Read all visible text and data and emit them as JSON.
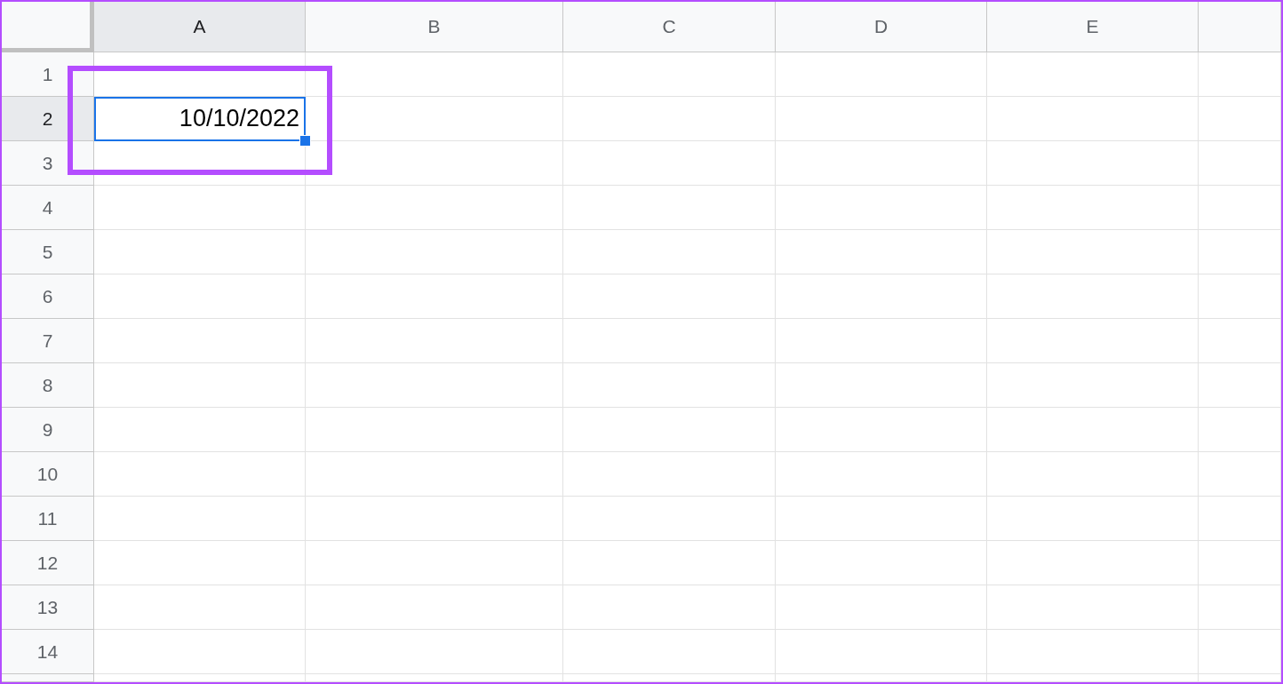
{
  "columns": [
    {
      "label": "A",
      "selected": true
    },
    {
      "label": "B",
      "selected": false
    },
    {
      "label": "C",
      "selected": false
    },
    {
      "label": "D",
      "selected": false
    },
    {
      "label": "E",
      "selected": false
    }
  ],
  "rows": [
    {
      "label": "1",
      "selected": false
    },
    {
      "label": "2",
      "selected": true,
      "cells": [
        {
          "value": "10/10/2022",
          "selected": true,
          "annotated": true
        }
      ]
    },
    {
      "label": "3",
      "selected": false
    },
    {
      "label": "4",
      "selected": false
    },
    {
      "label": "5",
      "selected": false
    },
    {
      "label": "6",
      "selected": false
    },
    {
      "label": "7",
      "selected": false
    },
    {
      "label": "8",
      "selected": false
    },
    {
      "label": "9",
      "selected": false
    },
    {
      "label": "10",
      "selected": false
    },
    {
      "label": "11",
      "selected": false
    },
    {
      "label": "12",
      "selected": false
    },
    {
      "label": "13",
      "selected": false
    },
    {
      "label": "14",
      "selected": false
    }
  ]
}
